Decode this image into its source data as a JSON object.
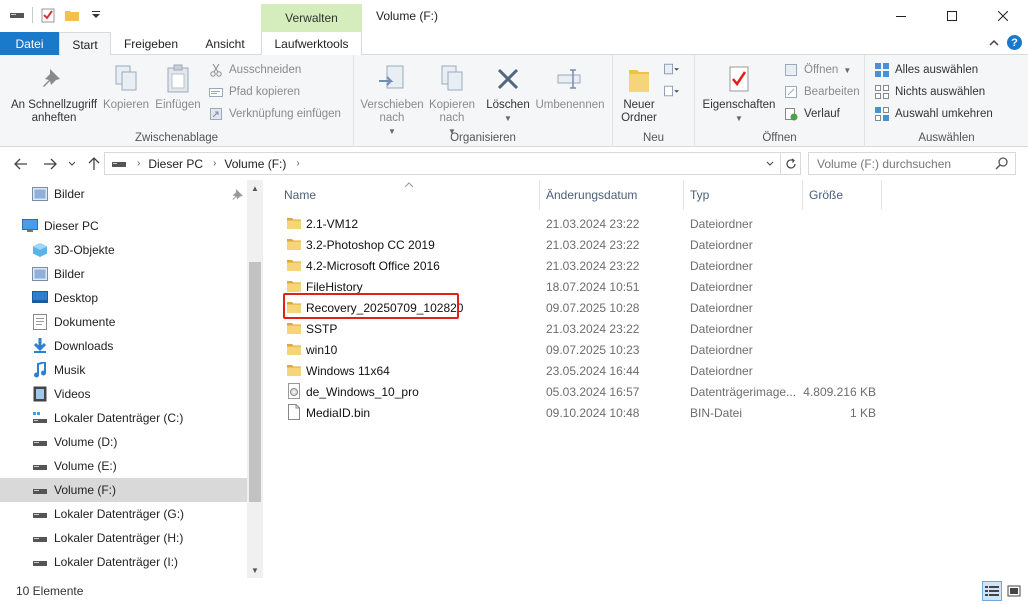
{
  "window": {
    "title": "Volume (F:)",
    "context_tab_header": "Verwalten",
    "controls": {
      "minimize": "—",
      "maximize": "☐",
      "close": "✕"
    }
  },
  "ribbon_tabs": {
    "datei": "Datei",
    "start": "Start",
    "freigeben": "Freigeben",
    "ansicht": "Ansicht",
    "laufwerktools": "Laufwerktools"
  },
  "ribbon": {
    "zwischenablage": {
      "label": "Zwischenablage",
      "pin": "An Schnellzugriff\nanheften",
      "kopieren": "Kopieren",
      "einfuegen": "Einfügen",
      "ausschneiden": "Ausschneiden",
      "pfad_kopieren": "Pfad kopieren",
      "verknuepfung": "Verknüpfung einfügen"
    },
    "organisieren": {
      "label": "Organisieren",
      "verschieben": "Verschieben\nnach",
      "kopieren_nach": "Kopieren\nnach",
      "loeschen": "Löschen",
      "umbenennen": "Umbenennen"
    },
    "neu": {
      "label": "Neu",
      "neuer_ordner": "Neuer\nOrdner"
    },
    "oeffnen": {
      "label": "Öffnen",
      "eigenschaften": "Eigenschaften",
      "oeffnen": "Öffnen",
      "bearbeiten": "Bearbeiten",
      "verlauf": "Verlauf"
    },
    "auswaehlen": {
      "label": "Auswählen",
      "alles": "Alles auswählen",
      "nichts": "Nichts auswählen",
      "umkehren": "Auswahl umkehren"
    }
  },
  "address": {
    "crumbs": [
      "Dieser PC",
      "Volume (F:)"
    ],
    "search_placeholder": "Volume (F:) durchsuchen"
  },
  "nav": {
    "items": [
      {
        "label": "Bilder",
        "icon": "pictures-icon"
      },
      {
        "label": "Dieser PC",
        "icon": "this-pc-icon"
      },
      {
        "label": "3D-Objekte",
        "icon": "3d-objects-icon"
      },
      {
        "label": "Bilder",
        "icon": "pictures-icon"
      },
      {
        "label": "Desktop",
        "icon": "desktop-icon"
      },
      {
        "label": "Dokumente",
        "icon": "documents-icon"
      },
      {
        "label": "Downloads",
        "icon": "downloads-icon"
      },
      {
        "label": "Musik",
        "icon": "music-icon"
      },
      {
        "label": "Videos",
        "icon": "videos-icon"
      },
      {
        "label": "Lokaler Datenträger (C:)",
        "icon": "system-drive-icon"
      },
      {
        "label": "Volume (D:)",
        "icon": "drive-icon"
      },
      {
        "label": "Volume (E:)",
        "icon": "drive-icon"
      },
      {
        "label": "Volume (F:)",
        "icon": "drive-icon",
        "selected": true
      },
      {
        "label": "Lokaler Datenträger (G:)",
        "icon": "drive-icon"
      },
      {
        "label": "Lokaler Datenträger (H:)",
        "icon": "drive-icon"
      },
      {
        "label": "Lokaler Datenträger (I:)",
        "icon": "drive-icon"
      }
    ]
  },
  "columns": {
    "name": "Name",
    "date": "Änderungsdatum",
    "type": "Typ",
    "size": "Größe"
  },
  "files": [
    {
      "name": "2.1-VM12",
      "date": "21.03.2024 23:22",
      "type": "Dateiordner",
      "size": "",
      "icon": "folder-icon"
    },
    {
      "name": "3.2-Photoshop CC 2019",
      "date": "21.03.2024 23:22",
      "type": "Dateiordner",
      "size": "",
      "icon": "folder-icon"
    },
    {
      "name": "4.2-Microsoft Office 2016",
      "date": "21.03.2024 23:22",
      "type": "Dateiordner",
      "size": "",
      "icon": "folder-icon"
    },
    {
      "name": "FileHistory",
      "date": "18.07.2024 10:51",
      "type": "Dateiordner",
      "size": "",
      "icon": "folder-icon"
    },
    {
      "name": "Recovery_20250709_102820",
      "date": "09.07.2025 10:28",
      "type": "Dateiordner",
      "size": "",
      "icon": "folder-icon"
    },
    {
      "name": "SSTP",
      "date": "21.03.2024 23:22",
      "type": "Dateiordner",
      "size": "",
      "icon": "folder-icon"
    },
    {
      "name": "win10",
      "date": "09.07.2025 10:23",
      "type": "Dateiordner",
      "size": "",
      "icon": "folder-icon"
    },
    {
      "name": "Windows 11x64",
      "date": "23.05.2024 16:44",
      "type": "Dateiordner",
      "size": "",
      "icon": "folder-icon"
    },
    {
      "name": "de_Windows_10_pro",
      "date": "05.03.2024 16:57",
      "type": "Datenträgerimage...",
      "size": "4.809.216 KB",
      "icon": "disc-image-icon"
    },
    {
      "name": "MediaID.bin",
      "date": "09.10.2024 10:48",
      "type": "BIN-Datei",
      "size": "1 KB",
      "icon": "file-icon"
    }
  ],
  "status": {
    "count": "10 Elemente"
  },
  "colors": {
    "accent": "#1979ca",
    "verwalten_bg": "#d5ecbd",
    "highlight_border": "#e0211a",
    "folder": "#f0c24b"
  }
}
